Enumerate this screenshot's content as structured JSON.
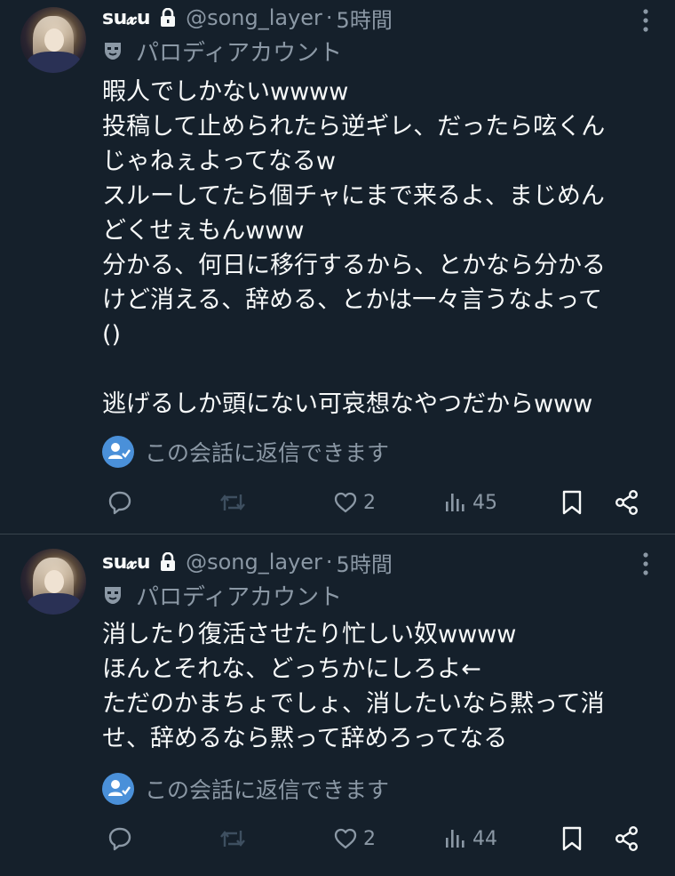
{
  "tweets": [
    {
      "name": "su𝔁u",
      "handle": "@song_layer",
      "separator": "·",
      "time": "5時間",
      "label": "パロディアカウント",
      "body": "暇人でしかないwwww\n投稿して止められたら逆ギレ、だったら呟くん\nじゃねぇよってなるw\nスルーしてたら個チャにまで来るよ、まじめん\nどくせぇもんwww\n分かる、何日に移行するから、とかなら分かる\nけど消える、辞める、とかは一々言うなよって\n()\n\n逃げるしか頭にない可哀想なやつだからwww",
      "reply_note": "この会話に返信できます",
      "likes": "2",
      "views": "45"
    },
    {
      "name": "su𝔁u",
      "handle": "@song_layer",
      "separator": "·",
      "time": "5時間",
      "label": "パロディアカウント",
      "body": "消したり復活させたり忙しい奴wwww\nほんとそれな、どっちかにしろよ←\nただのかまちょでしょ、消したいなら黙って消\nせ、辞めるなら黙って辞めろってなる",
      "reply_note": "この会話に返信できます",
      "likes": "2",
      "views": "44"
    }
  ],
  "icons": [
    "lock-icon",
    "more-icon",
    "mask-icon",
    "reply-info-icon",
    "reply-icon",
    "repost-icon",
    "like-icon",
    "views-icon",
    "bookmark-icon",
    "share-icon"
  ],
  "colors": {
    "background": "#15202b",
    "text": "#f7f9f9",
    "muted": "#8b98a5",
    "accent": "#4a90d9",
    "divider": "#38444d"
  }
}
